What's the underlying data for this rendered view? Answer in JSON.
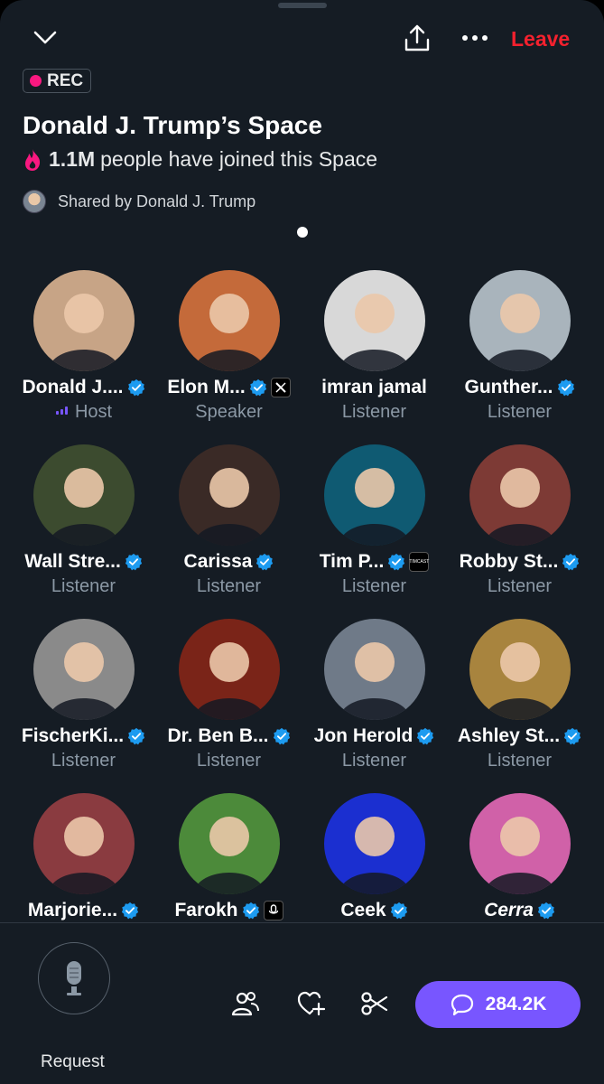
{
  "header": {
    "leave_label": "Leave",
    "rec_label": "REC",
    "title": "Donald J. Trump’s Space",
    "joined_count": "1.1M",
    "joined_text": "people have joined this Space",
    "shared_by": "Shared by Donald J. Trump"
  },
  "participants": [
    {
      "name": "Donald J....",
      "role": "Host",
      "verified": true,
      "affiliate": "",
      "bg": "#c7a486"
    },
    {
      "name": "Elon M...",
      "role": "Speaker",
      "verified": true,
      "affiliate": "X",
      "bg": "#c46a3a"
    },
    {
      "name": "imran jamal",
      "role": "Listener",
      "verified": false,
      "affiliate": "",
      "bg": "#d8d8d8"
    },
    {
      "name": "Gunther...",
      "role": "Listener",
      "verified": true,
      "affiliate": "",
      "bg": "#a9b4bc"
    },
    {
      "name": "Wall Stre...",
      "role": "Listener",
      "verified": true,
      "affiliate": "",
      "bg": "#3c4b2f"
    },
    {
      "name": "Carissa",
      "role": "Listener",
      "verified": true,
      "affiliate": "",
      "bg": "#3a2a26"
    },
    {
      "name": "Tim P...",
      "role": "Listener",
      "verified": true,
      "affiliate": "TIMCAST",
      "bg": "#0f5a72"
    },
    {
      "name": "Robby St...",
      "role": "Listener",
      "verified": true,
      "affiliate": "",
      "bg": "#7d3a35"
    },
    {
      "name": "FischerKi...",
      "role": "Listener",
      "verified": true,
      "affiliate": "",
      "bg": "#8a8a8a"
    },
    {
      "name": "Dr. Ben B...",
      "role": "Listener",
      "verified": true,
      "affiliate": "",
      "bg": "#7a2418"
    },
    {
      "name": "Jon Herold",
      "role": "Listener",
      "verified": true,
      "affiliate": "",
      "bg": "#6f7a88"
    },
    {
      "name": "Ashley St...",
      "role": "Listener",
      "verified": true,
      "affiliate": "",
      "bg": "#a8843e"
    },
    {
      "name": "Marjorie...",
      "role": "",
      "verified": true,
      "affiliate": "",
      "bg": "#8a3b40"
    },
    {
      "name": "Farokh",
      "role": "",
      "verified": true,
      "affiliate": "mic",
      "bg": "#4c8a3a"
    },
    {
      "name": "Ceek",
      "role": "",
      "verified": true,
      "affiliate": "",
      "bg": "#1b2fd0"
    },
    {
      "name": "Cerra",
      "role": "",
      "verified": true,
      "affiliate": "",
      "bg": "#d061a8"
    }
  ],
  "footer": {
    "request_label": "Request",
    "reply_count": "284.2K"
  },
  "colors": {
    "accent": "#7856ff",
    "leave": "#f4212e",
    "rec_dot": "#f91880",
    "verified": "#1d9bf0"
  }
}
